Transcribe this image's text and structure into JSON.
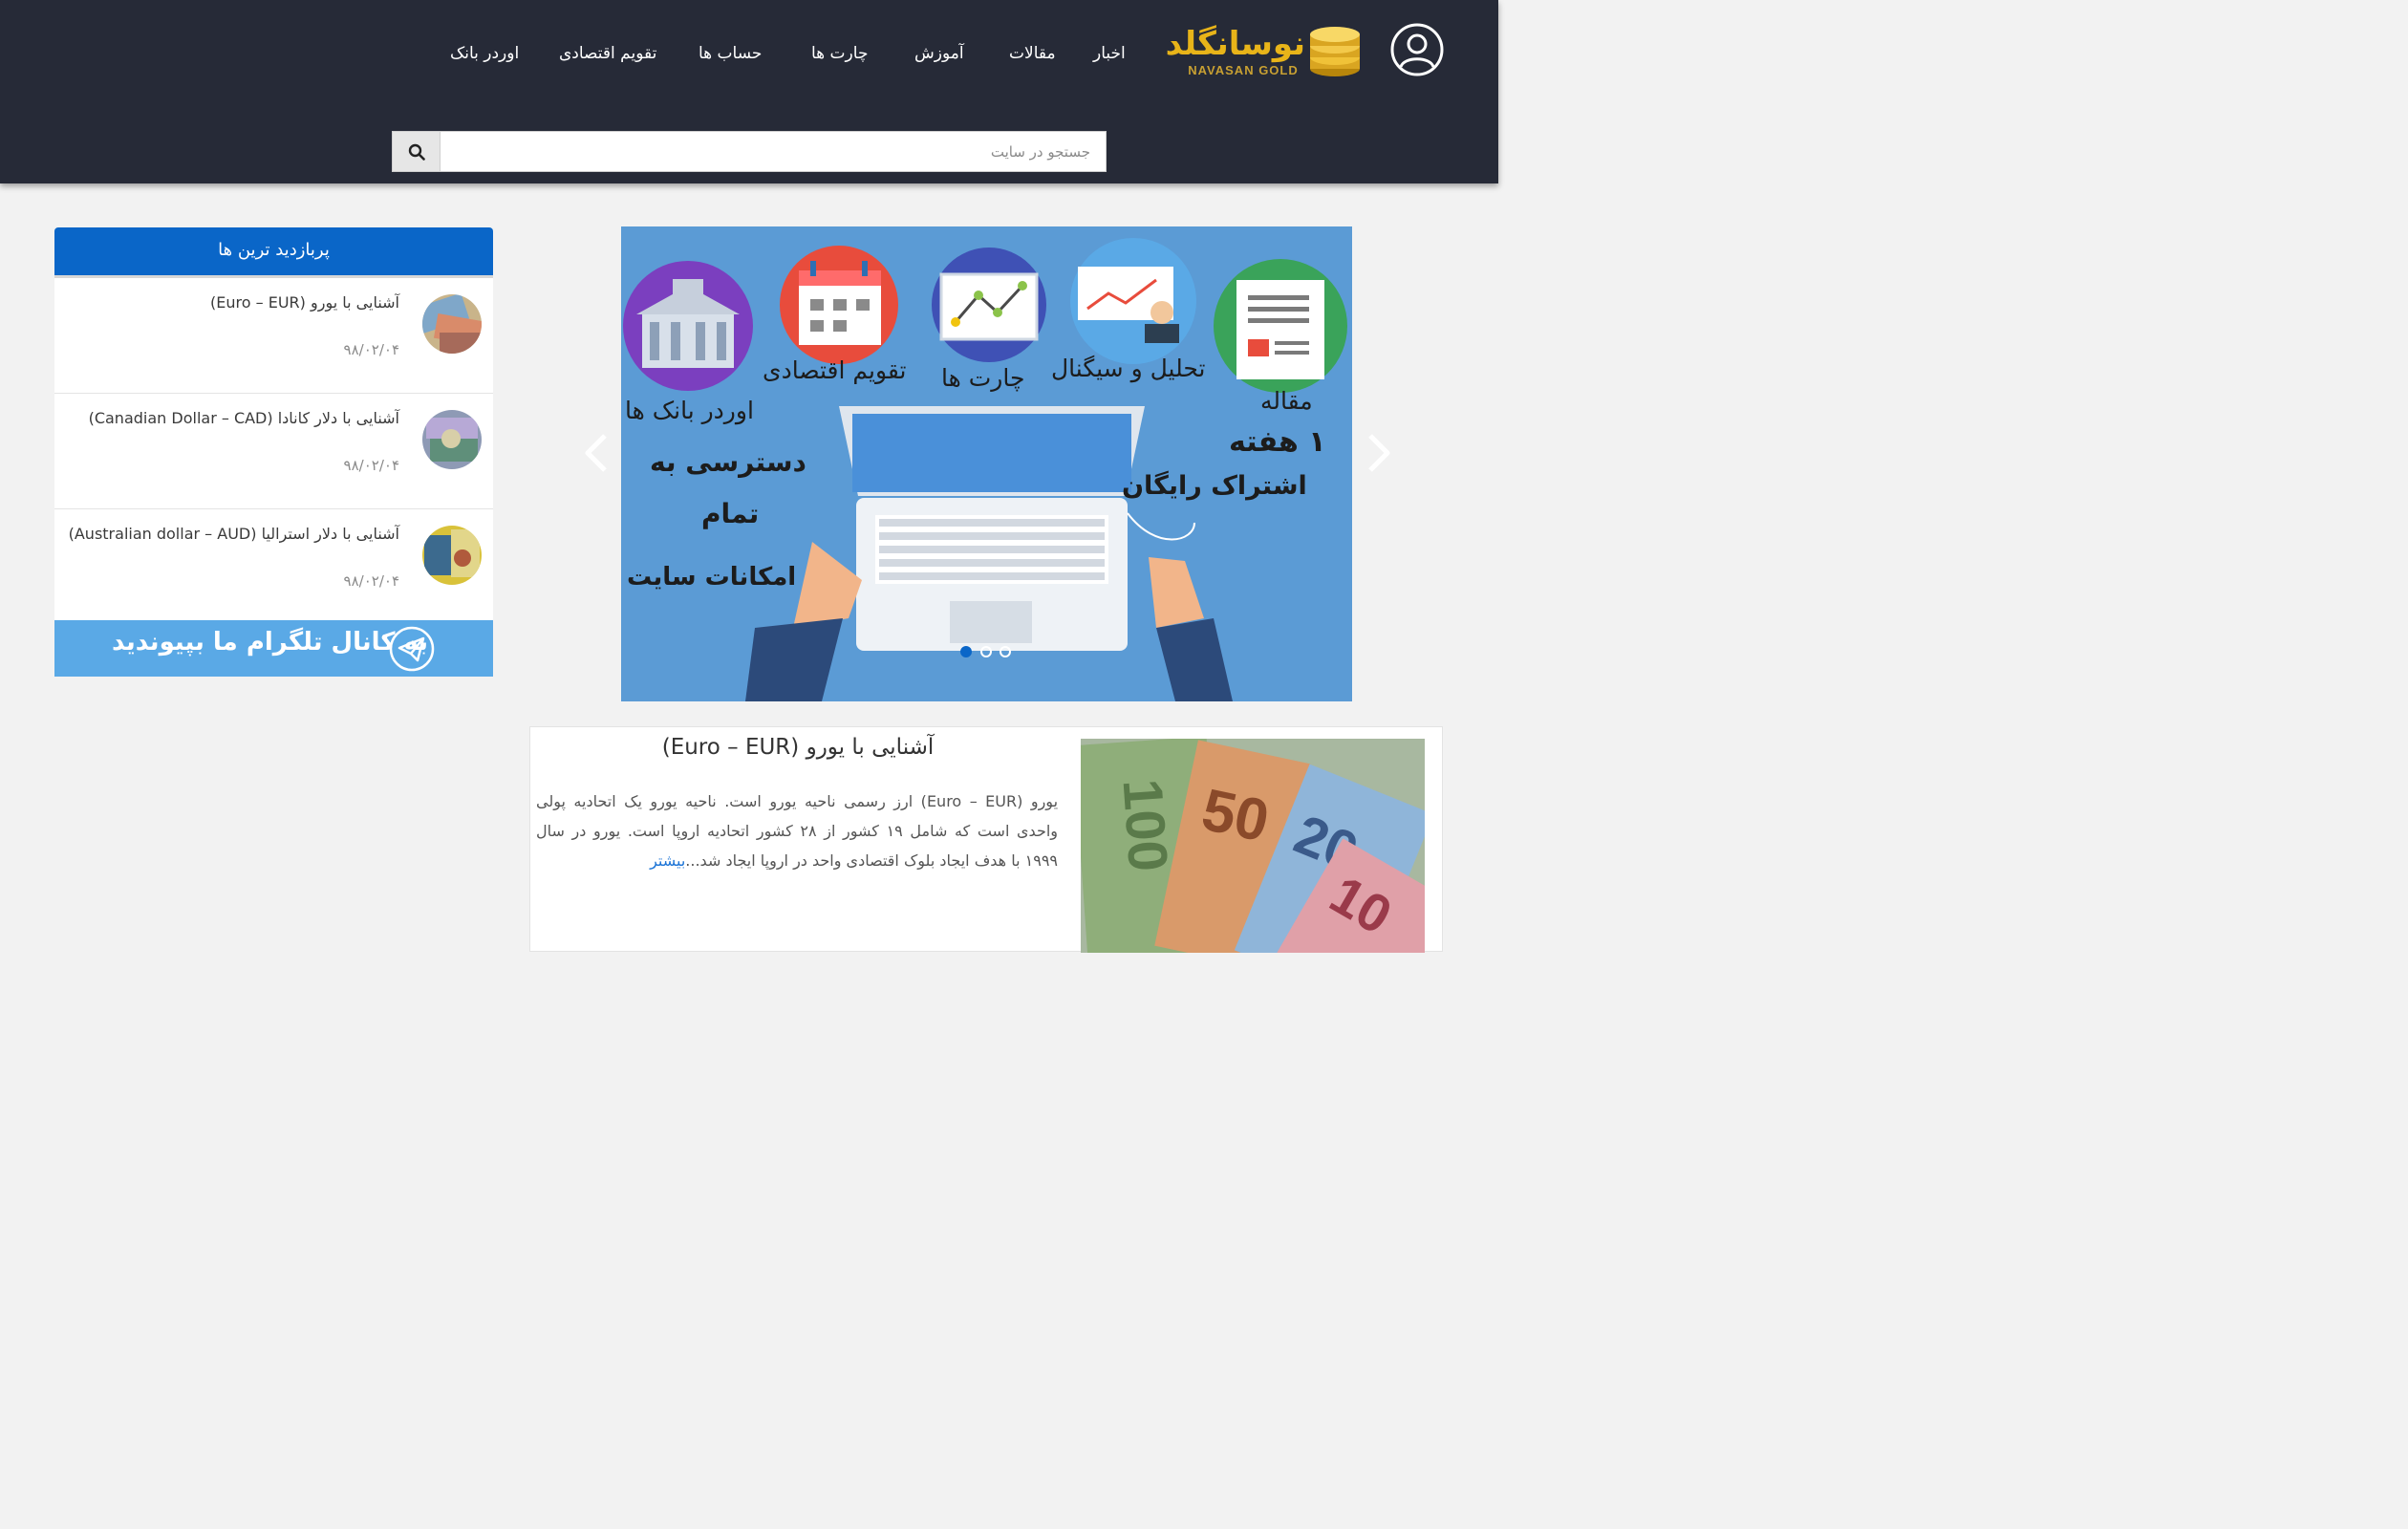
{
  "header": {
    "logo_text": "نوسانگلد",
    "logo_subtext": "NAVASAN GOLD",
    "nav": [
      {
        "label": "اخبار"
      },
      {
        "label": "مقالات"
      },
      {
        "label": "آموزش"
      },
      {
        "label": "چارت ها"
      },
      {
        "label": "حساب ها"
      },
      {
        "label": "تقویم اقتصادی"
      },
      {
        "label": "اوردر بانک"
      }
    ],
    "search": {
      "placeholder": "جستجو در سایت",
      "value": ""
    }
  },
  "slider": {
    "labels": {
      "article": "مقاله",
      "analysis": "تحلیل و سیگنال",
      "charts": "چارت ها",
      "calendar": "تقویم اقتصادی",
      "bank": "اوردر بانک ها"
    },
    "promo_week": "۱ هفته",
    "promo_free": "اشتراک رایگان",
    "access_1": "دسترسی به",
    "access_2": "تمام",
    "access_3": "امکانات سایت",
    "slide_count": 3,
    "active_slide": 1
  },
  "sidebar": {
    "title": "پربازدید ترین ها",
    "items": [
      {
        "title": "آشنایی با یورو (Euro – EUR)",
        "date": "۹۸/۰۲/۰۴"
      },
      {
        "title": "آشنایی با دلار کانادا (Canadian Dollar – CAD)",
        "date": "۹۸/۰۲/۰۴"
      },
      {
        "title": "آشنایی با دلار استرالیا (Australian dollar – AUD)",
        "date": "۹۸/۰۲/۰۴"
      }
    ],
    "telegram_label": "به کانال تلگرام ما بپیوندید"
  },
  "article": {
    "title": "آشنایی با یورو (Euro – EUR)",
    "body": "یورو (Euro – EUR) ارز رسمی ناحیه یورو است. ناحیه یورو یک اتحادیه پولی واحدی است که شامل ۱۹ کشور از ۲۸ کشور اتحادیه اروپا است. یورو در سال ۱۹۹۹ با هدف ایجاد بلوک اقتصادی واحد در اروپا ایجاد شد...",
    "more": "بیشتر",
    "banknotes": [
      "100",
      "50",
      "20",
      "10"
    ]
  },
  "colors": {
    "header_bg": "#262a37",
    "accent_blue": "#0a66c8",
    "telegram_blue": "#5aa9e6",
    "slider_bg": "#5b9bd5",
    "logo_gold": "#e8b419"
  }
}
